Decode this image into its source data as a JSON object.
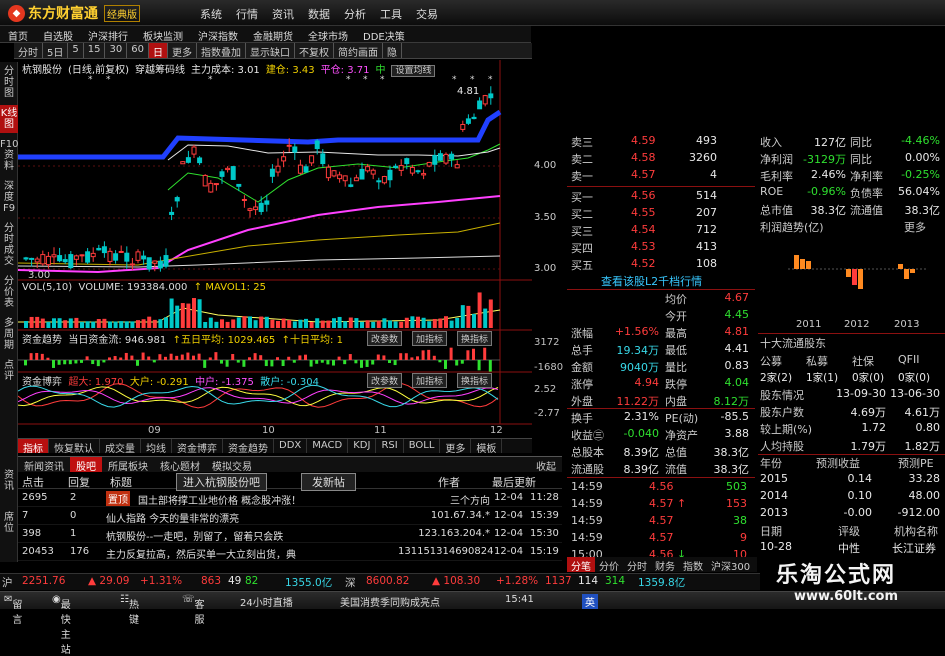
{
  "app": {
    "logo_text": "东方财富通",
    "edition": "经典版"
  },
  "topmenu": [
    "系统",
    "行情",
    "资讯",
    "数据",
    "分析",
    "工具",
    "交易"
  ],
  "nav": [
    "首页",
    "自选股",
    "沪深排行",
    "板块监测",
    "沪深指数",
    "金融期货",
    "全球市场",
    "DDE决策"
  ],
  "periods": [
    "分时",
    "5日",
    "5",
    "15",
    "30",
    "60",
    "日",
    "更多",
    "指数叠加",
    "显示缺口",
    "不复权",
    "简约画面",
    "隐"
  ],
  "left_tabs": [
    {
      "label": "分时图",
      "active": false
    },
    {
      "label": "K线图",
      "active": true
    },
    {
      "label": "F10资料",
      "active": false
    },
    {
      "label": "深度F9",
      "active": false
    },
    {
      "label": "分时成交",
      "active": false
    },
    {
      "label": "分价表",
      "active": false
    },
    {
      "label": "多周期",
      "active": false
    },
    {
      "label": "点评",
      "active": false
    }
  ],
  "left_bottom_tabs": [
    "资讯",
    "席位"
  ],
  "chart_header": {
    "stock": "杭钢股份",
    "mode": "(日线,前复权)",
    "indicator": "穿越筹码线",
    "main_cost": "主力成本: 3.01",
    "build": "建仓: 3.43",
    "flat": "平仓: 3.71",
    "mid": "中",
    "button": "设置均线"
  },
  "price_ticks": [
    "4.00",
    "3.50",
    "3.00"
  ],
  "price_high": "4.81",
  "price_low": "3.00",
  "vol_header": {
    "label": "VOL(5,10)",
    "volume": "VOLUME: 193384.000",
    "mavol": "MAVOL1: 25"
  },
  "fund_trend": {
    "label": "资金趋势",
    "today": "当日资金流: 946.981",
    "five": "五日平均: 1029.465",
    "ten": "十日平均: 1",
    "btn1": "改参数",
    "btn2": "加指标",
    "btn3": "换指标",
    "right_top": "3172",
    "right_bottom": "-1680"
  },
  "fund_bo": {
    "label": "资金博弈",
    "super": "超大: 1.970",
    "big": "大户: -0.291",
    "mid": "中户: -1.375",
    "small": "散户: -0.304",
    "btn1": "改参数",
    "btn2": "加指标",
    "btn3": "换指标",
    "right_top": "2.52",
    "right_bottom": "-2.77"
  },
  "x_axis": [
    "09",
    "10",
    "11",
    "12"
  ],
  "indicator_tabs": [
    {
      "label": "指标",
      "active": true
    },
    {
      "label": "恢复默认",
      "active": false
    },
    {
      "label": "成交量",
      "active": false
    },
    {
      "label": "均线",
      "active": false
    },
    {
      "label": "资金博弈",
      "active": false
    },
    {
      "label": "资金趋势",
      "active": false
    },
    {
      "label": "DDX",
      "active": false
    },
    {
      "label": "MACD",
      "active": false
    },
    {
      "label": "KDJ",
      "active": false
    },
    {
      "label": "RSI",
      "active": false
    },
    {
      "label": "BOLL",
      "active": false
    },
    {
      "label": "更多",
      "active": false
    },
    {
      "label": "模板",
      "active": false
    }
  ],
  "news": {
    "tabs": [
      {
        "label": "新闻资讯",
        "active": false
      },
      {
        "label": "股吧",
        "active": true
      },
      {
        "label": "所属板块",
        "active": false
      },
      {
        "label": "核心题材",
        "active": false
      },
      {
        "label": "模拟交易",
        "active": false
      }
    ],
    "collapse": "收起",
    "header": {
      "click": "点击",
      "reply": "回复",
      "title": "标题",
      "enter": "进入杭钢股份吧",
      "post": "发新帖",
      "author": "作者",
      "updated": "最后更新"
    },
    "rows": [
      {
        "click": "2695",
        "reply": "2",
        "badge": "置顶",
        "title": "国土部将撑工业地价格 概念股冲涨！",
        "author": "三个方向",
        "date": "12-04",
        "time": "11:28"
      },
      {
        "click": "7",
        "reply": "0",
        "badge": "",
        "title": "仙人指路 今天的量非常的漂亮",
        "author": "101.67.34.*",
        "date": "12-04",
        "time": "15:39"
      },
      {
        "click": "398",
        "reply": "1",
        "badge": "",
        "title": "杭钢股份--一走吧，别留了，留着只会跌",
        "author": "123.163.204.*",
        "date": "12-04",
        "time": "15:30"
      },
      {
        "click": "20453",
        "reply": "176",
        "badge": "",
        "title": "主力反复拉高，然后买单一大立刻出货，典",
        "author": "131151314690824",
        "date": "12-04",
        "time": "15:19"
      }
    ]
  },
  "quote": {
    "asks": [
      {
        "name": "卖三",
        "price": "4.59",
        "vol": "493"
      },
      {
        "name": "卖二",
        "price": "4.58",
        "vol": "3260"
      },
      {
        "name": "卖一",
        "price": "4.57",
        "vol": "4"
      }
    ],
    "bids": [
      {
        "name": "买一",
        "price": "4.56",
        "vol": "514"
      },
      {
        "name": "买二",
        "price": "4.55",
        "vol": "207"
      },
      {
        "name": "买三",
        "price": "4.54",
        "vol": "712"
      },
      {
        "name": "买四",
        "price": "4.53",
        "vol": "413"
      },
      {
        "name": "买五",
        "price": "4.52",
        "vol": "108"
      }
    ],
    "l2_link": "查看该股L2千档行情",
    "stats": [
      {
        "l1": "",
        "v1": "",
        "l2": "均价",
        "v2": "4.67"
      },
      {
        "l1": "",
        "v1": "",
        "l2": "今开",
        "v2": "4.45"
      },
      {
        "l1": "涨幅",
        "v1": "+1.56%",
        "l2": "最高",
        "v2": "4.81"
      },
      {
        "l1": "总手",
        "v1": "19.34万",
        "l2": "最低",
        "v2": "4.41"
      },
      {
        "l1": "金额",
        "v1": "9040万",
        "l2": "量比",
        "v2": "0.83"
      },
      {
        "l1": "涨停",
        "v1": "4.94",
        "l2": "跌停",
        "v2": "4.04"
      },
      {
        "l1": "外盘",
        "v1": "11.22万",
        "l2": "内盘",
        "v2": "8.12万"
      },
      {
        "l1": "换手",
        "v1": "2.31%",
        "l2": "PE(动)",
        "v2": "-85.5"
      },
      {
        "l1": "收益㊂",
        "v1": "-0.040",
        "l2": "净资产",
        "v2": "3.88"
      },
      {
        "l1": "总股本",
        "v1": "8.39亿",
        "l2": "总值",
        "v2": "38.3亿"
      },
      {
        "l1": "流通股",
        "v1": "8.39亿",
        "l2": "流值",
        "v2": "38.3亿"
      }
    ],
    "ticks": [
      {
        "time": "14:59",
        "price": "4.56",
        "vol": "503",
        "arrow": ""
      },
      {
        "time": "14:59",
        "price": "4.57",
        "vol": "153",
        "arrow": "↑"
      },
      {
        "time": "14:59",
        "price": "4.57",
        "vol": "38",
        "arrow": ""
      },
      {
        "time": "14:59",
        "price": "4.57",
        "vol": "9",
        "arrow": ""
      },
      {
        "time": "15:00",
        "price": "4.56",
        "vol": "10",
        "arrow": "↓"
      }
    ],
    "bottom_tabs": [
      "分笔",
      "分价",
      "分时",
      "财务",
      "指数",
      "沪深300"
    ]
  },
  "fin": {
    "top": [
      {
        "l": "收入",
        "v1": "127亿",
        "l2": "同比",
        "v2": "-4.46%"
      },
      {
        "l": "净利润",
        "v1": "-3129万",
        "l2": "同比",
        "v2": "0.00%"
      },
      {
        "l": "毛利率",
        "v1": "2.46%",
        "l2": "净利率",
        "v2": "-0.25%"
      },
      {
        "l": "ROE",
        "v1": "-0.96%",
        "l2": "负债率",
        "v2": "56.04%"
      },
      {
        "l": "总市值",
        "v1": "38.3亿",
        "l2": "流通值",
        "v2": "38.3亿"
      }
    ],
    "profit_label": "利润趋势(亿)",
    "more": "更多",
    "profit_years": [
      "2011",
      "2012",
      "2013"
    ],
    "holders_label": "十大流通股东",
    "holders_tabs": [
      "公募",
      "私募",
      "社保",
      "QFII"
    ],
    "holders_vals": [
      "2家(2)",
      "1家(1)",
      "0家(0)",
      "0家(0)"
    ],
    "holder_rows": [
      {
        "l": "股东情况",
        "v1": "13-09-30",
        "v2": "13-06-30"
      },
      {
        "l": "股东户数",
        "v1": "4.69万",
        "v2": "4.61万"
      },
      {
        "l": "较上期(%)",
        "v1": "1.72",
        "v2": "0.80"
      },
      {
        "l": "人均持股",
        "v1": "1.79万",
        "v2": "1.82万"
      }
    ],
    "forecast_header": {
      "year": "年份",
      "eps": "预测收益",
      "pe": "预测PE"
    },
    "forecast": [
      {
        "year": "2015",
        "eps": "0.14",
        "pe": "33.28"
      },
      {
        "year": "2014",
        "eps": "0.10",
        "pe": "48.00"
      },
      {
        "year": "2013",
        "eps": "-0.00",
        "pe": "-912.00"
      }
    ],
    "rating_header": {
      "date": "日期",
      "rating": "评级",
      "org": "机构名称"
    },
    "rating": {
      "date": "10-28",
      "rating": "中性",
      "org": "长江证券"
    }
  },
  "status": {
    "sh_label": "沪",
    "sh_index": "2251.76",
    "sh_chg": "▲ 29.09",
    "sh_pct": "+1.31%",
    "sh_up": "863",
    "sh_flat": "49",
    "sh_down": "82",
    "sh_amt": "1355.0亿",
    "sz_label": "深",
    "sz_index": "8600.82",
    "sz_chg": "▲ 108.30",
    "sz_pct": "+1.28%",
    "sz_up": "1137",
    "sz_flat": "114",
    "sz_down": "314",
    "sz_amt": "1359.8亿"
  },
  "taskbar": {
    "items": [
      "留言",
      "最快主站",
      "热键",
      "客服",
      "24小时直播"
    ],
    "headline": "美国消费季同购成亮点",
    "time": "15:41",
    "ime": "英"
  },
  "watermark": {
    "title": "乐淘公式网",
    "url": "www.60lt.com"
  },
  "colors": {
    "up": "#ff3c3c",
    "down": "#2fe02f",
    "accent": "#c01010"
  }
}
